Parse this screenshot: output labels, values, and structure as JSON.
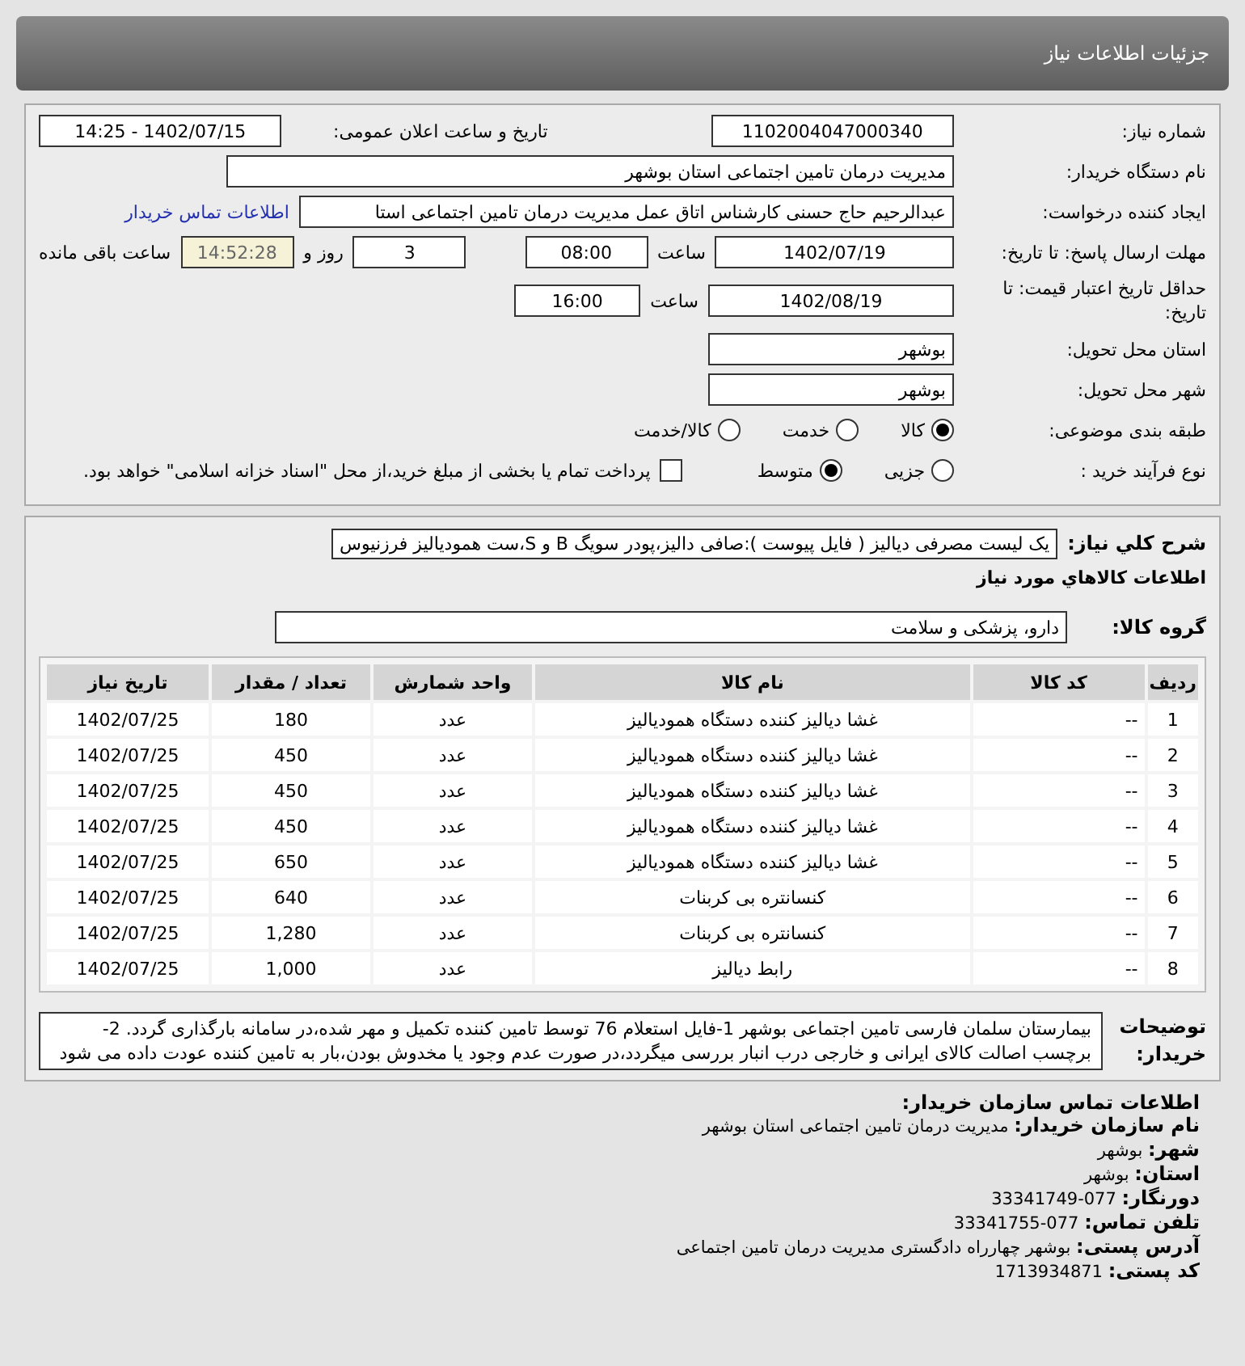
{
  "page_title": "جزئیات اطلاعات نیاز",
  "need": {
    "number_label": "شماره نیاز:",
    "number": "1102004047000340",
    "announce_label": "تاریخ و ساعت اعلان عمومی:",
    "announce": "1402/07/15 - 14:25",
    "buyer_label": "نام دستگاه خریدار:",
    "buyer": "مدیریت درمان تامین اجتماعی استان بوشهر",
    "creator_label": "ایجاد کننده درخواست:",
    "creator": "عبدالرحیم حاج حسنی کارشناس اتاق عمل مدیریت درمان تامین اجتماعی استا",
    "contact_link": "اطلاعات تماس خریدار",
    "deadline_label": "مهلت ارسال پاسخ: تا تاریخ:",
    "deadline_date": "1402/07/19",
    "deadline_time_label": "ساعت",
    "deadline_time": "08:00",
    "days": "3",
    "days_label": "روز و",
    "remaining": "14:52:28",
    "remaining_label": "ساعت باقی مانده",
    "validity_label": "حداقل تاریخ اعتبار قیمت: تا تاریخ:",
    "validity_date": "1402/08/19",
    "validity_time_label": "ساعت",
    "validity_time": "16:00",
    "province_label": "استان محل تحویل:",
    "province": "بوشهر",
    "city_label": "شهر محل تحویل:",
    "city": "بوشهر",
    "category_label": "طبقه بندی موضوعی:",
    "categories": [
      {
        "label": "کالا",
        "selected": true
      },
      {
        "label": "خدمت",
        "selected": false
      },
      {
        "label": "کالا/خدمت",
        "selected": false
      }
    ],
    "process_label": "نوع فرآیند خرید :",
    "processes": [
      {
        "label": "جزیی",
        "selected": false
      },
      {
        "label": "متوسط",
        "selected": true
      }
    ],
    "treasury": {
      "checked": false,
      "label": "پرداخت تمام یا بخشی از مبلغ خرید،از محل \"اسناد خزانه اسلامی\" خواهد بود."
    }
  },
  "items": {
    "summary_label": "شرح کلي نياز:",
    "summary": "یک لیست مصرفی دیالیز ( فایل پیوست ):صافی دالیز،پودر سویگ B و S،ست همودیالیز فرزنیوس",
    "heading": "اطلاعات كالاهاي مورد نياز",
    "group_label": "گروه کالا:",
    "group": "دارو، پزشکی و سلامت",
    "table": {
      "columns": [
        "ردیف",
        "کد کالا",
        "نام کالا",
        "واحد شمارش",
        "تعداد / مقدار",
        "تاریخ نیاز"
      ],
      "rows": [
        [
          "1",
          "--",
          "غشا دیالیز کننده دستگاه همودیالیز",
          "عدد",
          "180",
          "1402/07/25"
        ],
        [
          "2",
          "--",
          "غشا دیالیز کننده دستگاه همودیالیز",
          "عدد",
          "450",
          "1402/07/25"
        ],
        [
          "3",
          "--",
          "غشا دیالیز کننده دستگاه همودیالیز",
          "عدد",
          "450",
          "1402/07/25"
        ],
        [
          "4",
          "--",
          "غشا دیالیز کننده دستگاه همودیالیز",
          "عدد",
          "450",
          "1402/07/25"
        ],
        [
          "5",
          "--",
          "غشا دیالیز کننده دستگاه همودیالیز",
          "عدد",
          "650",
          "1402/07/25"
        ],
        [
          "6",
          "--",
          "کنسانتره بی کربنات",
          "عدد",
          "640",
          "1402/07/25"
        ],
        [
          "7",
          "--",
          "کنسانتره بی کربنات",
          "عدد",
          "1,280",
          "1402/07/25"
        ],
        [
          "8",
          "--",
          "رابط دیالیز",
          "عدد",
          "1,000",
          "1402/07/25"
        ]
      ]
    },
    "notes_label": "توضیحات خریدار:",
    "notes": "بیمارستان سلمان فارسی تامین اجتماعی بوشهر 1-فایل استعلام 76 توسط تامین کننده تکمیل و مهر شده،در سامانه بارگذاری گردد. 2-برچسب اصالت کالای ایرانی و خارجی درب انبار بررسی میگردد،در صورت عدم وجود یا مخدوش بودن،بار به تامین کننده عودت داده می شود"
  },
  "contact": {
    "heading": "اطلاعات تماس سازمان خریدار:",
    "fields": [
      {
        "label": "نام سازمان خریدار:",
        "value": "مدیریت درمان تامین اجتماعی استان بوشهر"
      },
      {
        "label": "شهر:",
        "value": "بوشهر"
      },
      {
        "label": "استان:",
        "value": "بوشهر"
      },
      {
        "label": "دورنگار:",
        "value": "077-33341749"
      },
      {
        "label": "تلفن تماس:",
        "value": "077-33341755"
      },
      {
        "label": "آدرس پستی:",
        "value": "بوشهر چهارراه دادگستری مدیریت درمان تامین اجتماعی"
      },
      {
        "label": "کد پستی:",
        "value": "1713934871"
      }
    ]
  }
}
